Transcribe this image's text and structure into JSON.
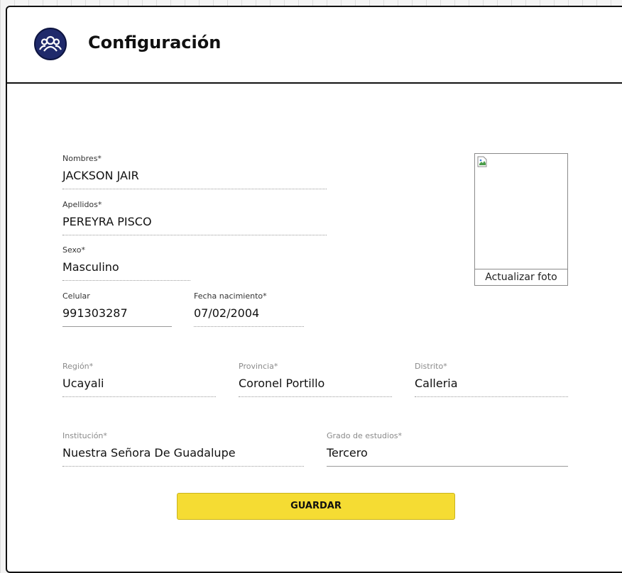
{
  "header": {
    "title": "Configuración",
    "logo_icon": "users-group-icon",
    "logo_color": "#1f2a6b"
  },
  "form": {
    "nombres": {
      "label": "Nombres*",
      "value": "JACKSON JAIR"
    },
    "apellidos": {
      "label": "Apellidos*",
      "value": "PEREYRA PISCO"
    },
    "sexo": {
      "label": "Sexo*",
      "value": "Masculino"
    },
    "celular": {
      "label": "Celular",
      "value": "991303287"
    },
    "fecha": {
      "label": "Fecha nacimiento*",
      "value": "07/02/2004"
    },
    "region": {
      "label": "Región*",
      "value": "Ucayali"
    },
    "provincia": {
      "label": "Provincia*",
      "value": "Coronel Portillo"
    },
    "distrito": {
      "label": "Distrito*",
      "value": "Calleria"
    },
    "institucion": {
      "label": "Institución*",
      "value": "Nuestra Señora De Guadalupe"
    },
    "grado": {
      "label": "Grado de estudios*",
      "value": "Tercero"
    }
  },
  "photo": {
    "caption": "Actualizar foto",
    "icon": "broken-image-icon"
  },
  "actions": {
    "save_label": "GUARDAR",
    "save_color": "#f5dc33"
  }
}
